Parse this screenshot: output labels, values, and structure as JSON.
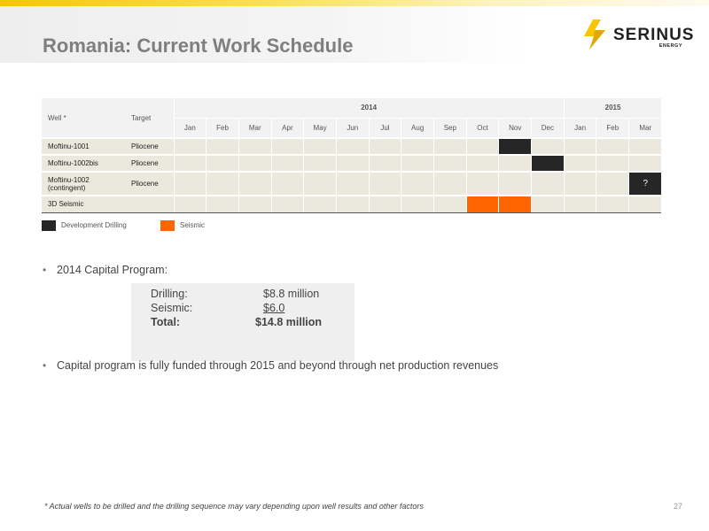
{
  "title": "Romania: Current Work Schedule",
  "logo": {
    "name": "SERINUS",
    "sub": "ENERGY"
  },
  "schedule": {
    "header_well": "Well *",
    "header_target": "Target",
    "years": [
      {
        "label": "2014",
        "span": 12
      },
      {
        "label": "2015",
        "span": 3
      }
    ],
    "months": [
      "Jan",
      "Feb",
      "Mar",
      "Apr",
      "May",
      "Jun",
      "Jul",
      "Aug",
      "Sep",
      "Oct",
      "Nov",
      "Dec",
      "Jan",
      "Feb",
      "Mar"
    ],
    "rows": [
      {
        "well": "Moftinu-1001",
        "target": "Pliocene",
        "activity": "drilling",
        "cells": [
          10
        ]
      },
      {
        "well": "Moftinu-1002bis",
        "target": "Pliocene",
        "activity": "drilling",
        "cells": [
          11
        ]
      },
      {
        "well": "Moftinu-1002 (contingent)",
        "target": "Pliocene",
        "activity": "drilling",
        "cells": [
          14
        ],
        "mark": "?"
      },
      {
        "well": "3D Seismic",
        "target": "",
        "activity": "seismic",
        "cells": [
          9,
          10
        ]
      }
    ]
  },
  "legend": {
    "drilling": "Development Drilling",
    "seismic": "Seismic",
    "drilling_color": "#262626",
    "seismic_color": "#ff6600"
  },
  "bullets": {
    "capital_program": "2014 Capital Program:",
    "funded": "Capital program is fully funded through 2015 and beyond through net production revenues"
  },
  "capital": {
    "drilling_label": "Drilling:",
    "drilling_value": "$8.8 million",
    "seismic_label": "Seismic:",
    "seismic_value": "$6.0",
    "total_label": "Total:",
    "total_value": "$14.8 million"
  },
  "footnote": "* Actual wells to be drilled and the drilling sequence may vary depending upon well results and other factors",
  "page_number": "27"
}
